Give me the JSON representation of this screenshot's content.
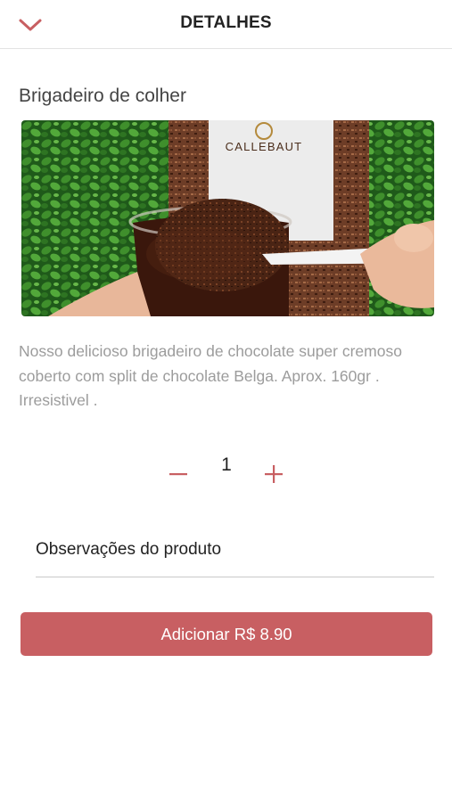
{
  "header": {
    "title": "DETALHES",
    "back_icon": "chevron-down-icon",
    "accent_color": "#c85f62"
  },
  "product": {
    "name": "Brigadeiro de colher",
    "image_brand_text": "CALLEBAUT",
    "description": "Nosso delicioso brigadeiro de chocolate super cremoso coberto com split de chocolate Belga. Aprox. 160gr . Irresistivel ."
  },
  "quantity": {
    "value": "1",
    "minus_icon": "minus-icon",
    "plus_icon": "plus-icon"
  },
  "notes": {
    "label": "Observações do produto"
  },
  "add_button": {
    "label": "Adicionar R$ 8.90",
    "color": "#c85f62"
  }
}
